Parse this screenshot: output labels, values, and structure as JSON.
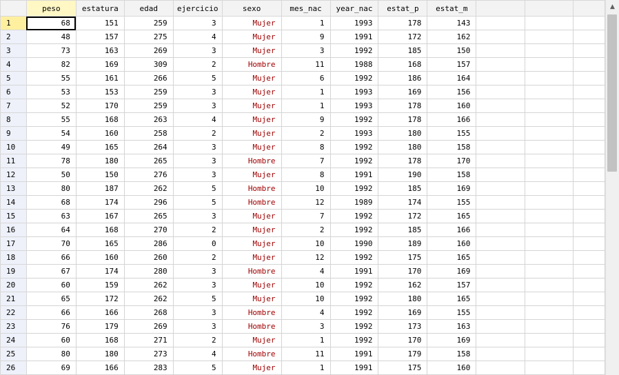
{
  "columns": [
    "peso",
    "estatura",
    "edad",
    "ejercicio",
    "sexo",
    "mes_nac",
    "year_nac",
    "estat_p",
    "estat_m"
  ],
  "string_column": "sexo",
  "selected": {
    "row": 1,
    "column": "peso"
  },
  "rows": [
    {
      "n": "1",
      "cells": [
        "68",
        "151",
        "259",
        "3",
        "Mujer",
        "1",
        "1993",
        "178",
        "143"
      ]
    },
    {
      "n": "2",
      "cells": [
        "48",
        "157",
        "275",
        "4",
        "Mujer",
        "9",
        "1991",
        "172",
        "162"
      ]
    },
    {
      "n": "3",
      "cells": [
        "73",
        "163",
        "269",
        "3",
        "Mujer",
        "3",
        "1992",
        "185",
        "150"
      ]
    },
    {
      "n": "4",
      "cells": [
        "82",
        "169",
        "309",
        "2",
        "Hombre",
        "11",
        "1988",
        "168",
        "157"
      ]
    },
    {
      "n": "5",
      "cells": [
        "55",
        "161",
        "266",
        "5",
        "Mujer",
        "6",
        "1992",
        "186",
        "164"
      ]
    },
    {
      "n": "6",
      "cells": [
        "53",
        "153",
        "259",
        "3",
        "Mujer",
        "1",
        "1993",
        "169",
        "156"
      ]
    },
    {
      "n": "7",
      "cells": [
        "52",
        "170",
        "259",
        "3",
        "Mujer",
        "1",
        "1993",
        "178",
        "160"
      ]
    },
    {
      "n": "8",
      "cells": [
        "55",
        "168",
        "263",
        "4",
        "Mujer",
        "9",
        "1992",
        "178",
        "166"
      ]
    },
    {
      "n": "9",
      "cells": [
        "54",
        "160",
        "258",
        "2",
        "Mujer",
        "2",
        "1993",
        "180",
        "155"
      ]
    },
    {
      "n": "10",
      "cells": [
        "49",
        "165",
        "264",
        "3",
        "Mujer",
        "8",
        "1992",
        "180",
        "158"
      ]
    },
    {
      "n": "11",
      "cells": [
        "78",
        "180",
        "265",
        "3",
        "Hombre",
        "7",
        "1992",
        "178",
        "170"
      ]
    },
    {
      "n": "12",
      "cells": [
        "50",
        "150",
        "276",
        "3",
        "Mujer",
        "8",
        "1991",
        "190",
        "158"
      ]
    },
    {
      "n": "13",
      "cells": [
        "80",
        "187",
        "262",
        "5",
        "Hombre",
        "10",
        "1992",
        "185",
        "169"
      ]
    },
    {
      "n": "14",
      "cells": [
        "68",
        "174",
        "296",
        "5",
        "Hombre",
        "12",
        "1989",
        "174",
        "155"
      ]
    },
    {
      "n": "15",
      "cells": [
        "63",
        "167",
        "265",
        "3",
        "Mujer",
        "7",
        "1992",
        "172",
        "165"
      ]
    },
    {
      "n": "16",
      "cells": [
        "64",
        "168",
        "270",
        "2",
        "Mujer",
        "2",
        "1992",
        "185",
        "166"
      ]
    },
    {
      "n": "17",
      "cells": [
        "70",
        "165",
        "286",
        "0",
        "Mujer",
        "10",
        "1990",
        "189",
        "160"
      ]
    },
    {
      "n": "18",
      "cells": [
        "66",
        "160",
        "260",
        "2",
        "Mujer",
        "12",
        "1992",
        "175",
        "165"
      ]
    },
    {
      "n": "19",
      "cells": [
        "67",
        "174",
        "280",
        "3",
        "Hombre",
        "4",
        "1991",
        "170",
        "169"
      ]
    },
    {
      "n": "20",
      "cells": [
        "60",
        "159",
        "262",
        "3",
        "Mujer",
        "10",
        "1992",
        "162",
        "157"
      ]
    },
    {
      "n": "21",
      "cells": [
        "65",
        "172",
        "262",
        "5",
        "Mujer",
        "10",
        "1992",
        "180",
        "165"
      ]
    },
    {
      "n": "22",
      "cells": [
        "66",
        "166",
        "268",
        "3",
        "Hombre",
        "4",
        "1992",
        "169",
        "155"
      ]
    },
    {
      "n": "23",
      "cells": [
        "76",
        "179",
        "269",
        "3",
        "Hombre",
        "3",
        "1992",
        "173",
        "163"
      ]
    },
    {
      "n": "24",
      "cells": [
        "60",
        "168",
        "271",
        "2",
        "Mujer",
        "1",
        "1992",
        "170",
        "169"
      ]
    },
    {
      "n": "25",
      "cells": [
        "80",
        "180",
        "273",
        "4",
        "Hombre",
        "11",
        "1991",
        "179",
        "158"
      ]
    },
    {
      "n": "26",
      "cells": [
        "69",
        "166",
        "283",
        "5",
        "Mujer",
        "1",
        "1991",
        "175",
        "160"
      ]
    }
  ],
  "icons": {
    "scroll_up": "chevron-up-icon"
  },
  "colors": {
    "string_text": "#a00000",
    "selected_header": "#fff7c4",
    "row_header": "#eef1fa"
  }
}
